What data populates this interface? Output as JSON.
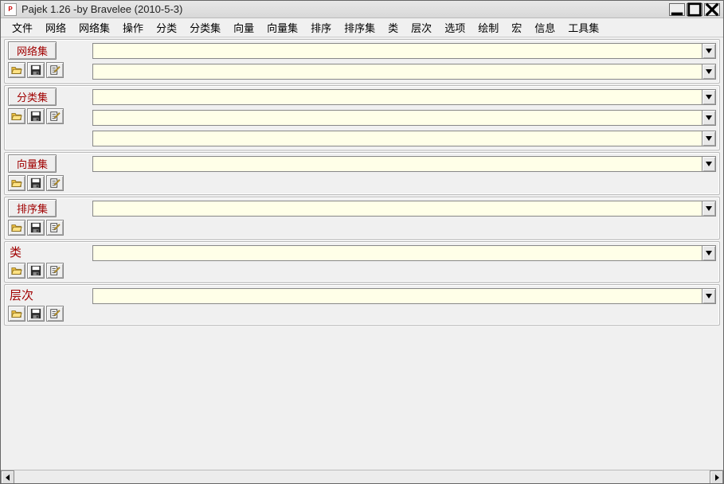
{
  "window": {
    "title": "Pajek 1.26 -by Bravelee (2010-5-3)"
  },
  "menu": {
    "items": [
      "文件",
      "网络",
      "网络集",
      "操作",
      "分类",
      "分类集",
      "向量",
      "向量集",
      "排序",
      "排序集",
      "类",
      "层次",
      "选项",
      "绘制",
      "宏",
      "信息",
      "工具集"
    ]
  },
  "panels": [
    {
      "label": "网络集",
      "label_style": "button",
      "combos": [
        "",
        ""
      ]
    },
    {
      "label": "分类集",
      "label_style": "button",
      "combos": [
        "",
        "",
        ""
      ]
    },
    {
      "label": "向量集",
      "label_style": "button",
      "combos": [
        ""
      ]
    },
    {
      "label": "排序集",
      "label_style": "button",
      "combos": [
        ""
      ]
    },
    {
      "label": "类",
      "label_style": "plain",
      "combos": [
        ""
      ]
    },
    {
      "label": "层次",
      "label_style": "plain",
      "combos": [
        ""
      ]
    }
  ],
  "icons": {
    "open": "open-icon",
    "save": "save-icon",
    "edit": "edit-icon"
  }
}
